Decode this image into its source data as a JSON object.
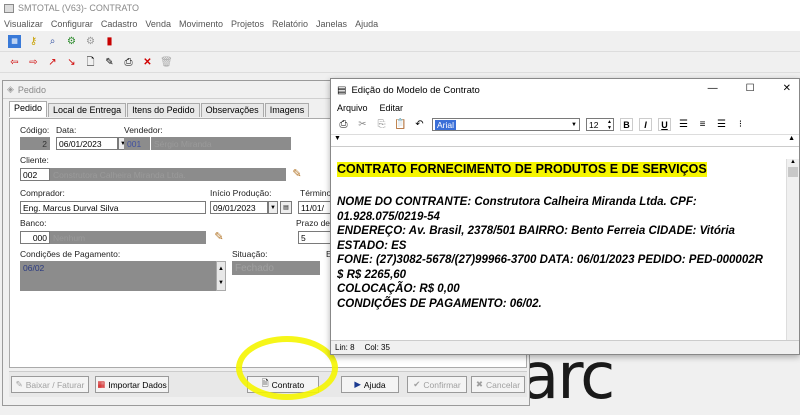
{
  "app": {
    "title": "SMTOTAL (V63)- CONTRATO"
  },
  "menu": [
    "Visualizar",
    "Configurar",
    "Cadastro",
    "Venda",
    "Movimento",
    "Projetos",
    "Relatório",
    "Janelas",
    "Ajuda"
  ],
  "pedido": {
    "title": "Pedido",
    "tabs": [
      "Pedido",
      "Local de Entrega",
      "Itens do Pedido",
      "Observações",
      "Imagens"
    ],
    "codigo_label": "Código:",
    "codigo_value": "2",
    "data_label": "Data:",
    "data_value": "06/01/2023",
    "vendedor_label": "Vendedor:",
    "vendedor_code": "001",
    "vendedor_name": "Sérgio Miranda",
    "cliente_label": "Cliente:",
    "cliente_code": "002",
    "cliente_name": "Construtora Calheira Miranda Ltda.",
    "comprador_label": "Comprador:",
    "comprador_value": "Eng. Marcus Durval Silva",
    "inicio_label": "Início Produção:",
    "inicio_value": "09/01/2023",
    "termino_label": "Término:",
    "termino_value": "11/01/",
    "banco_label": "Banco:",
    "banco_code": "000",
    "banco_name": "Nenhum",
    "prazo_label": "Prazo de E",
    "prazo_value": "5",
    "condicoes_label": "Condições de Pagamento:",
    "condicoes_value": "06/02",
    "situacao_label": "Situação:",
    "situacao_value": "Fechado",
    "e_label": "E",
    "buttons": {
      "baixar": "Baixar / Faturar",
      "importar": "Importar Dados",
      "contrato": "Contrato",
      "ajuda": "Ajuda",
      "confirmar": "Confirmar",
      "cancelar": "Cancelar"
    }
  },
  "editor": {
    "title": "Edição do Modelo de Contrato",
    "menu": [
      "Arquivo",
      "Editar"
    ],
    "font": "Arial",
    "size": "12",
    "lines": [
      "CONTRATO FORNECIMENTO DE PRODUTOS E DE SERVIÇOS",
      "",
      "NOME DO CONTRANTE: Construtora Calheira Miranda Ltda. CPF:",
      "01.928.075/0219-54",
      "ENDEREÇO: Av. Brasil, 2378/501  BAIRRO: Bento Ferreia CIDADE: Vitória",
      "ESTADO: ES",
      "FONE: (27)3082-5678/(27)99966-3700  DATA: 06/01/2023 PEDIDO: PED-000002R",
      "$ R$ 2265,60",
      "COLOCAÇÃO: R$ 0,00",
      "CONDIÇÕES DE PAGAMENTO: 06/02."
    ],
    "status_lin": "Lin:  8",
    "status_col": "Col:  35"
  },
  "colors": {
    "highlight": "#f5f500",
    "selection": "#3a6fd8"
  }
}
